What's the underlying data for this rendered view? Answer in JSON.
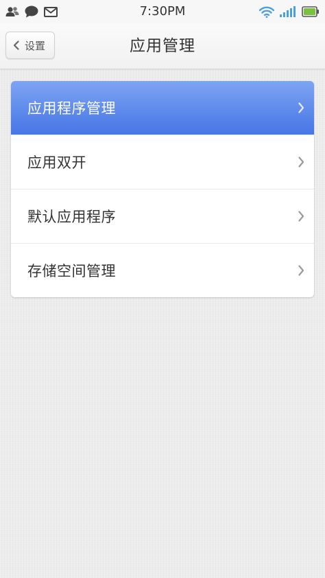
{
  "status_bar": {
    "time": "7:30PM",
    "left_icons": [
      "contacts-icon",
      "chat-bubble-icon",
      "mail-icon"
    ],
    "right_icons": [
      "wifi-icon",
      "signal-icon",
      "battery-icon"
    ]
  },
  "header": {
    "back_label": "设置",
    "title": "应用管理"
  },
  "menu": {
    "items": [
      {
        "label": "应用程序管理",
        "selected": true
      },
      {
        "label": "应用双开",
        "selected": false
      },
      {
        "label": "默认应用程序",
        "selected": false
      },
      {
        "label": "存储空间管理",
        "selected": false
      }
    ]
  },
  "colors": {
    "accent_top": "#7ea4f2",
    "accent_bottom": "#4676e6",
    "wifi": "#4a9fe0",
    "signal": "#4a9fe0",
    "battery": "#7ac143"
  }
}
